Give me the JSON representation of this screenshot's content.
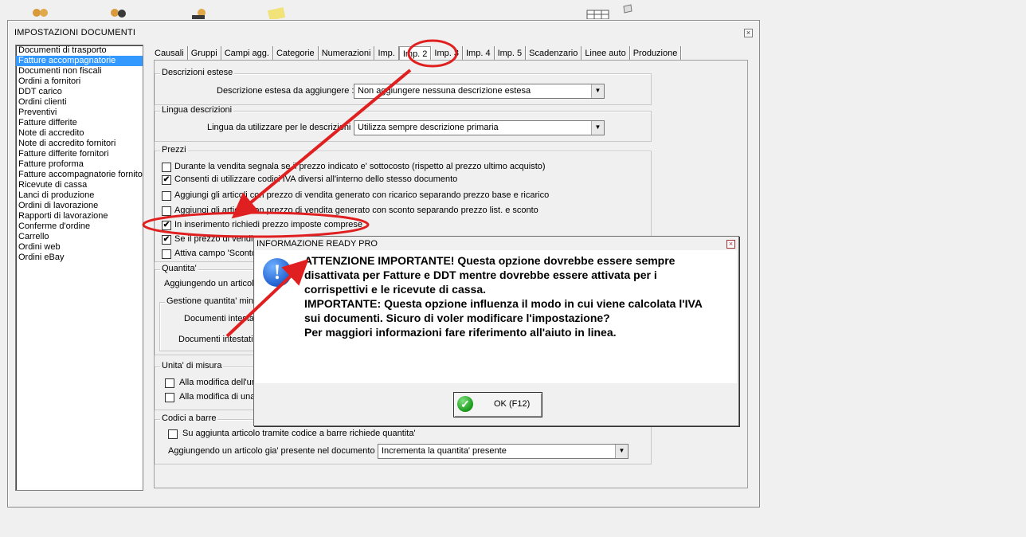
{
  "window": {
    "title": "IMPOSTAZIONI DOCUMENTI",
    "close": "×"
  },
  "doc_list": [
    "Documenti di trasporto",
    "Fatture accompagnatorie",
    "Documenti non fiscali",
    "Ordini a fornitori",
    "DDT carico",
    "Ordini clienti",
    "Preventivi",
    "Fatture differite",
    "Note di accredito",
    "Note di accredito fornitori",
    "Fatture differite fornitori",
    "Fatture proforma",
    "Fatture accompagnatorie fornitori",
    "Ricevute di cassa",
    "Lanci di produzione",
    "Ordini di lavorazione",
    "Rapporti di lavorazione",
    "Conferme d'ordine",
    "Carrello",
    "Ordini web",
    "Ordini eBay"
  ],
  "doc_list_selected": 1,
  "tabs": [
    "Causali",
    "Gruppi",
    "Campi agg.",
    "Categorie",
    "Numerazioni",
    "Imp.",
    "Imp. 2",
    "Imp. 3",
    "Imp. 4",
    "Imp. 5",
    "Scadenzario",
    "Linee auto",
    "Produzione"
  ],
  "active_tab": "Imp. 2",
  "descrizioni": {
    "title": "Descrizioni estese",
    "label": "Descrizione estesa da aggiungere :",
    "value": "Non aggiungere nessuna descrizione estesa"
  },
  "lingua": {
    "title": "Lingua descrizioni",
    "label": "Lingua da utilizzare per le descrizioni :",
    "value": "Utilizza sempre descrizione primaria"
  },
  "prezzi": {
    "title": "Prezzi",
    "items": [
      {
        "label": "Durante la vendita segnala se il prezzo indicato e' sottocosto (rispetto al prezzo ultimo acquisto)",
        "checked": false
      },
      {
        "label": "Consenti di utilizzare codici IVA diversi all'interno dello stesso documento",
        "checked": true
      },
      {
        "label": "Aggiungi gli articoli con prezzo di vendita generato con ricarico separando prezzo base e ricarico",
        "checked": false
      },
      {
        "label": "Aggiungi gli articoli con prezzo di vendita generato con sconto separando prezzo list. e sconto",
        "checked": false
      },
      {
        "label": "In inserimento richiedi prezzo imposte comprese",
        "checked": true
      },
      {
        "label": "Se il prezzo di vendita",
        "checked": true
      },
      {
        "label": "Attiva campo 'Sconto",
        "checked": false
      }
    ]
  },
  "quantita": {
    "title": "Quantita'",
    "label1": "Aggiungendo un articol",
    "subgroup": "Gestione quantita' minim",
    "row1": "Documenti intestati",
    "row2": "Documenti intestati"
  },
  "unita": {
    "title": "Unita' di misura",
    "items": [
      {
        "label": "Alla modifica dell'un",
        "checked": false
      },
      {
        "label": "Alla modifica di una",
        "checked": false
      }
    ]
  },
  "codici": {
    "title": "Codici a barre",
    "check_label": "Su aggiunta articolo tramite codice a barre richiede quantita'",
    "checked": false,
    "label": "Aggiungendo un articolo gia' presente nel documento :",
    "value": "Incrementa la quantita' presente"
  },
  "dialog": {
    "title": "INFORMAZIONE READY PRO",
    "close": "×",
    "icon": "!",
    "message": "ATTENZIONE IMPORTANTE! Questa opzione dovrebbe essere sempre\ndisattivata per Fatture e DDT mentre dovrebbe essere attivata per i\ncorrispettivi e le ricevute di cassa.\nIMPORTANTE: Questa opzione influenza il modo in cui viene calcolata l'IVA\nsui documenti. Sicuro di voler modificare l'impostazione?\nPer maggiori informazioni fare riferimento all'aiuto in linea.",
    "ok_label": "OK (F12)",
    "ok_icon": "✓"
  },
  "combo_arrow": "▼",
  "check_mark": "✔",
  "colors": {
    "selection": "#3399ff",
    "annotation": "#e02020"
  }
}
